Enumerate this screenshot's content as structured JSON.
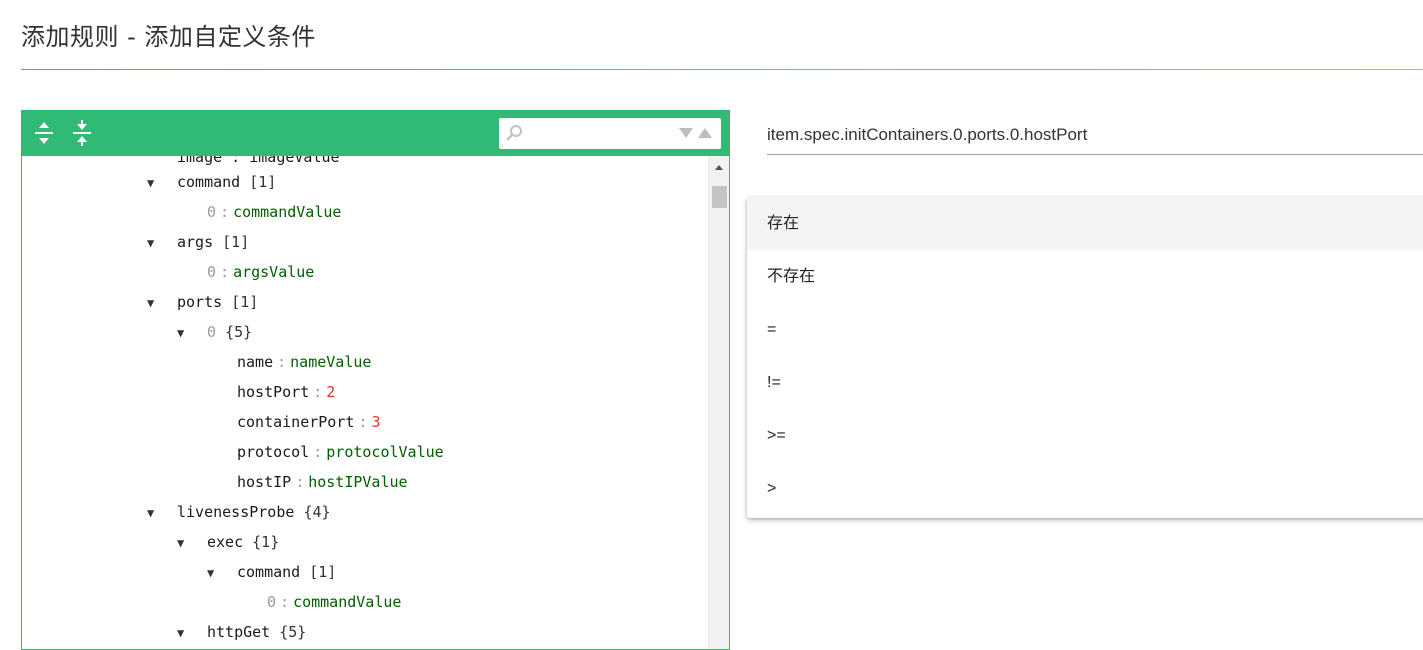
{
  "page": {
    "title": "添加规则 - 添加自定义条件"
  },
  "editor": {
    "toolbar": {
      "expand_icon": "expand-all-icon",
      "collapse_icon": "collapse-all-icon",
      "search_icon": "search-icon",
      "search_placeholder": ""
    },
    "partial_top_row": "image : imageValue",
    "rows": [
      {
        "key": "command",
        "count": "[1]"
      },
      {
        "key": "0",
        "value": "commandValue"
      },
      {
        "key": "args",
        "count": "[1]"
      },
      {
        "key": "0",
        "value": "argsValue"
      },
      {
        "key": "ports",
        "count": "[1]"
      },
      {
        "key": "0",
        "count": "{5}"
      },
      {
        "key": "name",
        "value": "nameValue"
      },
      {
        "key": "hostPort",
        "value": "2"
      },
      {
        "key": "containerPort",
        "value": "3"
      },
      {
        "key": "protocol",
        "value": "protocolValue"
      },
      {
        "key": "hostIP",
        "value": "hostIPValue"
      },
      {
        "key": "livenessProbe",
        "count": "{4}"
      },
      {
        "key": "exec",
        "count": "{1}"
      },
      {
        "key": "command",
        "count": "[1]"
      },
      {
        "key": "0",
        "value": "commandValue"
      },
      {
        "key": "httpGet",
        "count": "{5}"
      }
    ]
  },
  "path": {
    "value": "item.spec.initContainers.0.ports.0.hostPort"
  },
  "operators": {
    "options": [
      "存在",
      "不存在",
      "=",
      "!=",
      ">=",
      ">"
    ],
    "highlighted": "存在"
  },
  "colors": {
    "toolbar_green": "#31ba76",
    "string_value": "#006000",
    "number_value": "#e0362a"
  }
}
